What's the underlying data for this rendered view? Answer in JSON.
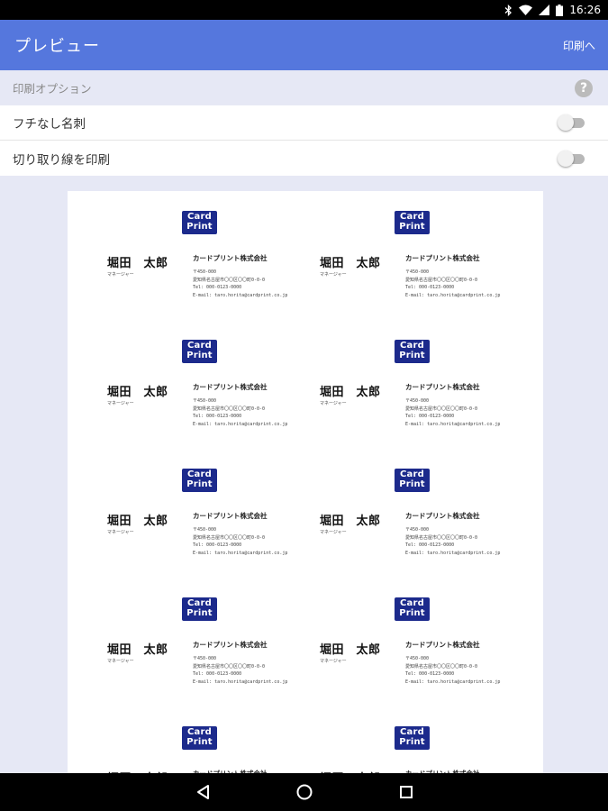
{
  "status_bar": {
    "time": "16:26",
    "icons": [
      "bluetooth-icon",
      "wifi-icon",
      "signal-icon",
      "battery-icon"
    ]
  },
  "app_bar": {
    "title": "プレビュー",
    "action_label": "印刷へ"
  },
  "print_options": {
    "header": "印刷オプション",
    "help_glyph": "?",
    "rows": [
      {
        "label": "フチなし名刺",
        "enabled": false
      },
      {
        "label": "切り取り線を印刷",
        "enabled": false
      }
    ]
  },
  "card": {
    "logo_line1": "Card",
    "logo_line2": "Print",
    "name": "堀田　太郎",
    "title": "マネージャー",
    "company": "カードプリント株式会社",
    "postal": "〒450-000",
    "address": "愛知県名古屋市〇〇区〇〇町0-0-0",
    "tel": "Tel: 000-0123-0000",
    "email": "E-mail: taro.horita@cardprint.co.jp"
  },
  "colors": {
    "app_bar": "#5577dd",
    "background": "#e6e8f5",
    "logo": "#1c2a8c"
  },
  "navigation": {
    "buttons": [
      "back-icon",
      "home-icon",
      "recents-icon"
    ]
  }
}
